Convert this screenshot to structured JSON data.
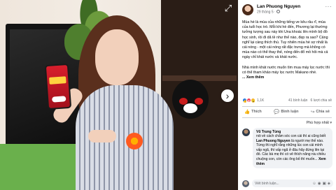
{
  "viewer": {
    "expand_icon": "expand-icon",
    "next_icon": "chevron-right-icon"
  },
  "post": {
    "author": "Lan Phuong Nguyen",
    "time": "29 tháng 5 · ",
    "paragraphs": [
      "Mùa hè là mùa của những tiếng ve kêu râu rĩ, mùa của tuổi học trò. Mỗi khi hè đến, Phương lại thường tưởng tượng sau này khi Una khoác lên mình bộ đồ học sinh, rồi đi dã tề như thế nào, đẹp ra sao? Cảng nghĩ lại càng thích thú. Tuy nhiên mùa hè sợ nhất là cái nóng - một cái nóng rất đặc trưng mà không có mùa nào có thể thay thế, nóng đến đổ mồ hôi mà cả ngày chỉ khát nước và khát nước.",
      "Nhà mình khát nước muốn tìm mua máy lọc nước thì có thể tham khảo máy lọc nước Makano nhé."
    ],
    "see_more": "... Xem thêm",
    "reactions_count": "1,1K",
    "comments_count": "41 bình luận",
    "shares_count": "6 lượt chia sẻ",
    "actions": {
      "like": "Thích",
      "comment": "Bình luận",
      "share": "Chia sẻ"
    },
    "sort_label": "Phù hợp nhất ▾"
  },
  "comment": {
    "author": "Vũ Trung Tùng",
    "text_before": "nói về cách chăm sóc con cái thì ai cũng biết ",
    "mention": "Lan Phuong Nguyen",
    "text_after": " là người mẹ thế nào. Từng thì nghĩ rằng những lúc con cái mình vấp ngã, thì vấp ngã ở đâu hãy đứng lên tại đó. Các bà mẹ thì có vẻ thích năng niu chiều chuộng con, còn các ông bố thì muốn... ",
    "see_more": "Xem thêm"
  },
  "write_box": {
    "placeholder": "Viết bình luận..."
  }
}
